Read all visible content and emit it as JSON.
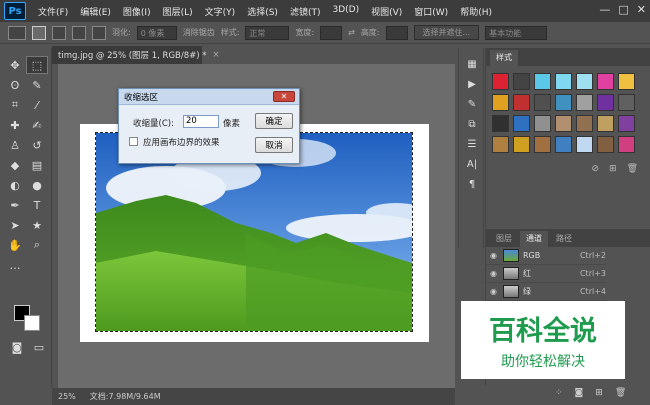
{
  "app": {
    "logo": "Ps"
  },
  "menu": [
    "文件(F)",
    "编辑(E)",
    "图像(I)",
    "图层(L)",
    "文字(Y)",
    "选择(S)",
    "滤镜(T)",
    "3D(D)",
    "视图(V)",
    "窗口(W)",
    "帮助(H)"
  ],
  "window_controls": {
    "minimize": "—",
    "maximize": "□",
    "close": "✕"
  },
  "options_bar": {
    "feather_label": "羽化:",
    "feather_value": "0 像素",
    "antialias_label": "消除锯齿",
    "style_label": "样式:",
    "style_value": "正常",
    "width_label": "宽度:",
    "height_label": "高度:",
    "select_mask_button": "选择并遮住...",
    "workspace_value": "基本功能"
  },
  "document": {
    "tab_title": "timg.jpg @ 25% (图层 1, RGB/8#) *",
    "tab_close": "×",
    "zoom": "25%",
    "doc_info": "文档:7.98M/9.64M"
  },
  "dialog": {
    "title": "收缩选区",
    "close": "✕",
    "amount_label": "收缩量(C):",
    "amount_value": "20",
    "unit": "像素",
    "checkbox_label": "应用画布边界的效果",
    "ok_label": "确定",
    "cancel_label": "取消"
  },
  "styles_panel": {
    "tab": "样式",
    "swatches": [
      "#d23",
      "#444",
      "#5bc8e8",
      "#7fd8f0",
      "#9fe0f0",
      "#e040a0",
      "#f0c040",
      "#e0a020",
      "#c03030",
      "#505050",
      "#4090c0",
      "#a0a0a0",
      "#7030a0",
      "#606060",
      "#303030",
      "#3070c0",
      "#909090",
      "#b09070",
      "#907050",
      "#c0a060",
      "#8040a0",
      "#b08040",
      "#d0a020",
      "#a07040",
      "#4080c0",
      "#c0d8f0",
      "#806040",
      "#d04080"
    ]
  },
  "channels_panel": {
    "tabs": [
      "图层",
      "通道",
      "路径"
    ],
    "active_tab": "通道",
    "rows": [
      {
        "name": "RGB",
        "shortcut": "Ctrl+2"
      },
      {
        "name": "红",
        "shortcut": "Ctrl+3"
      },
      {
        "name": "绿",
        "shortcut": "Ctrl+4"
      }
    ]
  },
  "watermark": {
    "title": "百科全说",
    "subtitle": "助你轻松解决"
  },
  "colors": {
    "accent": "#31a8ff",
    "watermark_green": "#1f9b4e",
    "dialog_bg": "#e8eef6"
  }
}
